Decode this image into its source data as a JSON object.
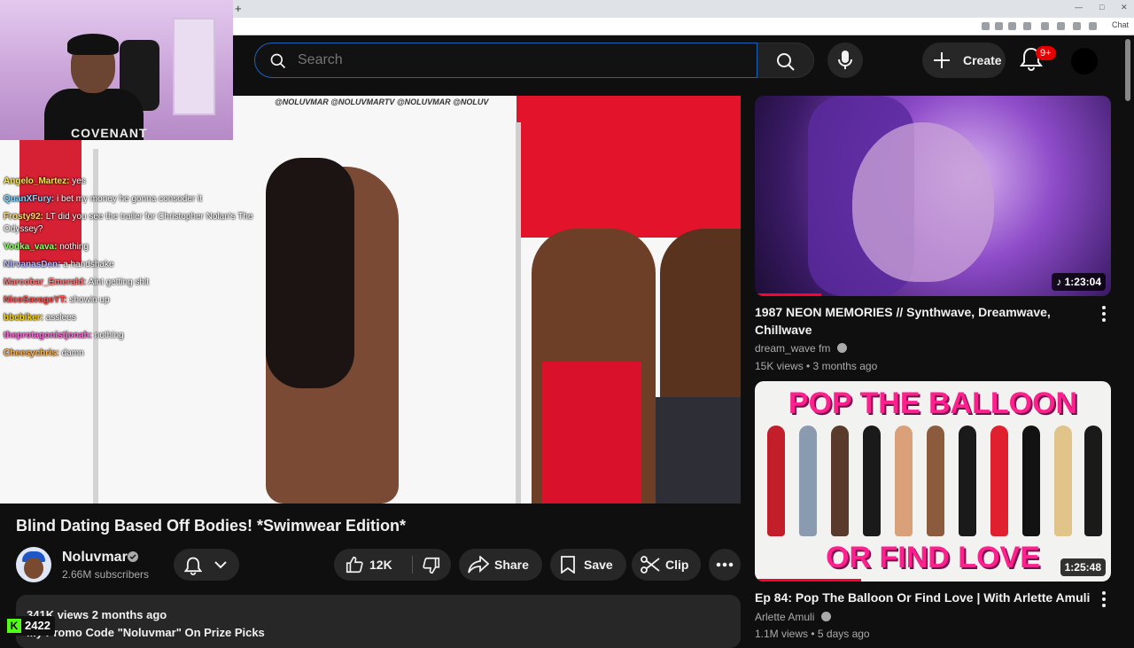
{
  "browser": {
    "new_tab_symbol": "+",
    "chat_ext": "Chat"
  },
  "header": {
    "search_placeholder": "Search",
    "create_label": "Create",
    "notifications_count": "9+"
  },
  "webcam": {
    "shirt_text": "COVENANT"
  },
  "video": {
    "watermark": "@NOLUVMAR  @NOLUVMARTV  @NOLUVMAR  @NOLUV",
    "title": "Blind Dating Based Off Bodies! *Swimwear Edition*",
    "channel": "Noluvmar",
    "subscribers": "2.66M subscribers",
    "likes": "12K",
    "share": "Share",
    "save": "Save",
    "clip": "Clip",
    "views_and_date": "341K views  2 months ago",
    "promo": "My Promo Code \"Noluvmar\" On Prize Picks"
  },
  "chat": [
    {
      "user": "Angelo_Martez:",
      "msg": "yes",
      "color": "#f7e463"
    },
    {
      "user": "QuanXFury:",
      "msg": "i bet my money he gonna consoder it",
      "color": "#7fd4ff"
    },
    {
      "user": "Frosty92:",
      "msg": "LT did you see the trailer for Christopher Nolan's The",
      "color": "#ffd86b"
    },
    {
      "user": "",
      "msg": "Odyssey?",
      "color": "#ffffff"
    },
    {
      "user": "Vodka_vava:",
      "msg": "nothing",
      "color": "#8cff6a"
    },
    {
      "user": "NirvanasDen:",
      "msg": "a handshake",
      "color": "#b9b9ff"
    },
    {
      "user": "Marcobar_Emerald:",
      "msg": "Aint getting shit",
      "color": "#ff7a7a"
    },
    {
      "user": "NicoSavageYT:",
      "msg": "showin up",
      "color": "#ff4f4f"
    },
    {
      "user": "bbcbiker:",
      "msg": "asslees",
      "color": "#ffd300"
    },
    {
      "user": "theprotagonistjonah:",
      "msg": "nothing",
      "color": "#ff6bd8"
    },
    {
      "user": "Cheesychris:",
      "msg": "damn",
      "color": "#ffb24d"
    }
  ],
  "kick": {
    "viewers": "2422",
    "logo": "K"
  },
  "recommendations": [
    {
      "title": "1987 NEON MEMORIES // Synthwave, Dreamwave, Chillwave",
      "channel": "dream_wave fm",
      "meta": "15K views • 3 months ago",
      "duration": "1:23:04",
      "music_icon": "♪"
    },
    {
      "title": "Ep 84: Pop The Balloon Or Find Love | With Arlette Amuli",
      "channel": "Arlette Amuli",
      "meta": "1.1M views • 5 days ago",
      "duration": "1:25:48",
      "thumb_top": "POP THE BALLOON",
      "thumb_bottom": "OR FIND LOVE"
    }
  ],
  "colors": {
    "accent_red": "#ff0033",
    "search_focus": "#1c62b9",
    "kick_green": "#53fc18"
  }
}
